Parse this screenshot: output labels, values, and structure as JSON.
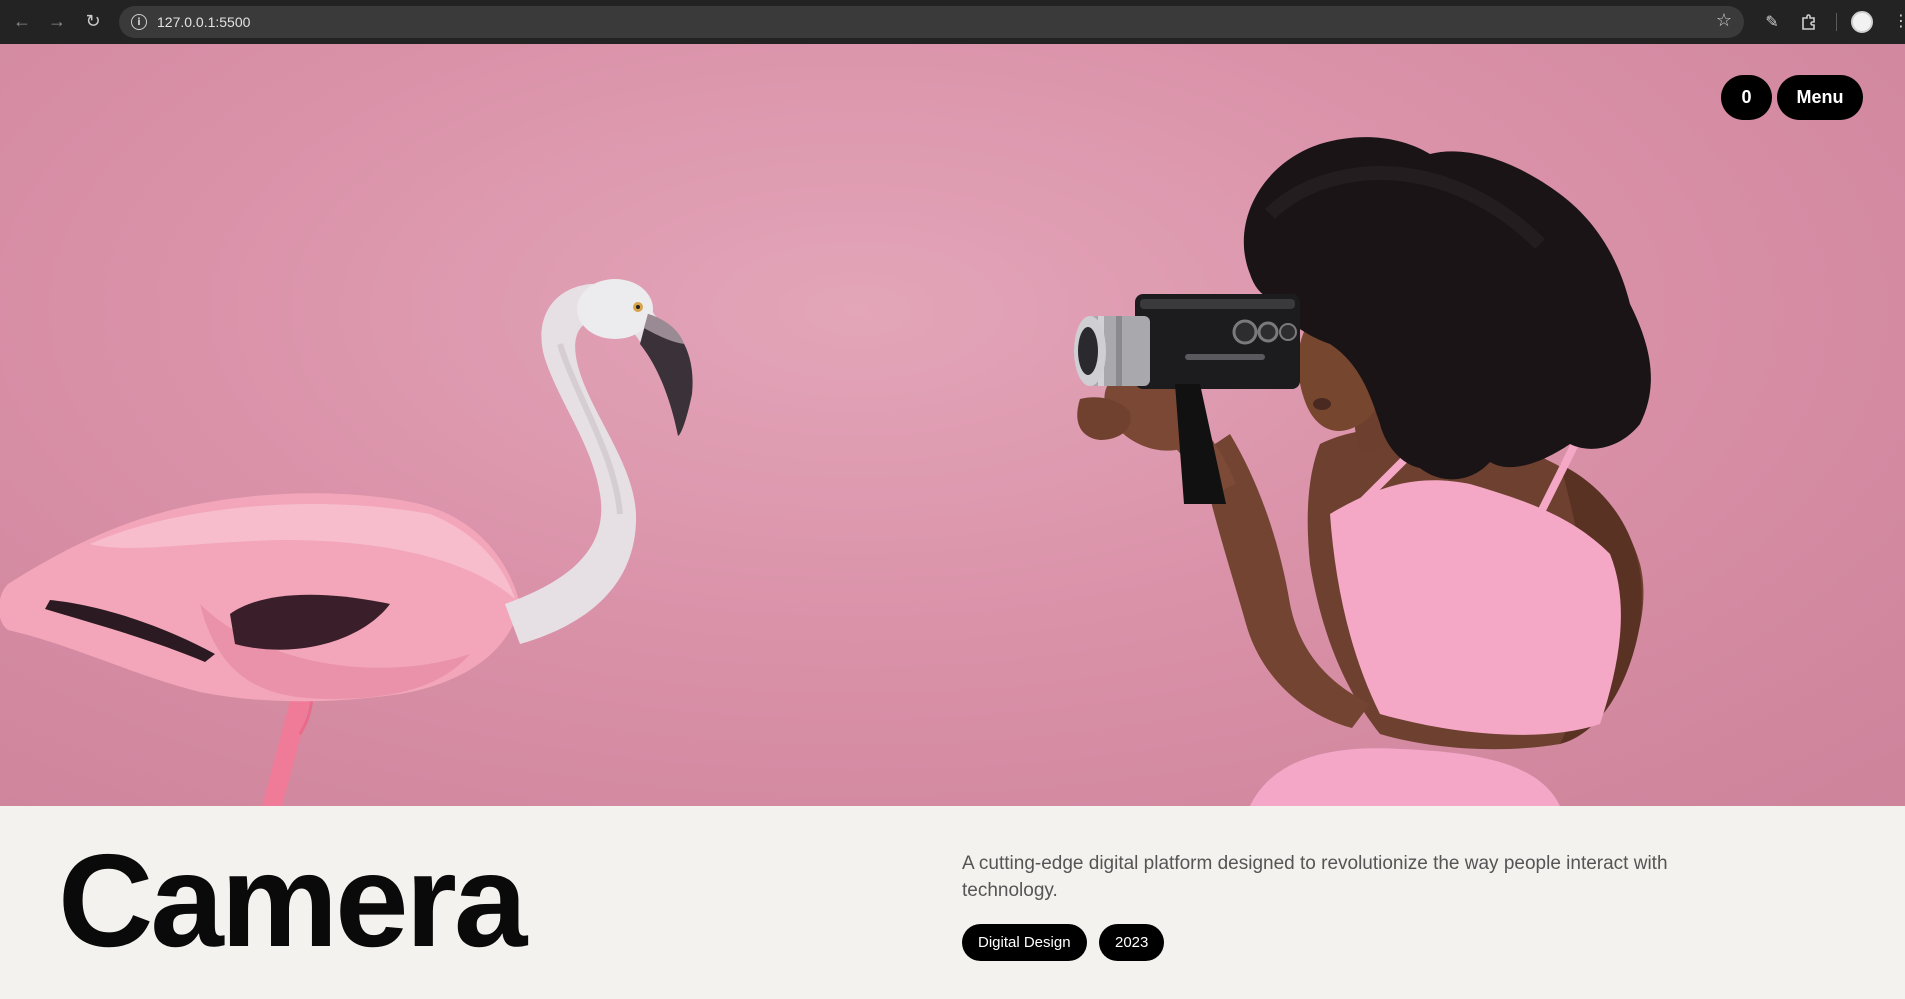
{
  "browser": {
    "url": "127.0.0.1:5500",
    "icons": {
      "back": "back-arrow-icon",
      "forward": "forward-arrow-icon",
      "reload": "reload-icon",
      "site_info": "info-icon",
      "bookmark": "star-icon",
      "edit": "pen-icon",
      "extensions": "puzzle-icon",
      "profile": "avatar-icon",
      "menu": "kebab-icon"
    }
  },
  "header": {
    "cart_count": "0",
    "menu_label": "Menu"
  },
  "project": {
    "title": "Camera",
    "description": "A cutting-edge digital platform designed to revolutionize the way people interact with technology.",
    "tags": [
      "Digital Design",
      "2023"
    ]
  },
  "colors": {
    "hero_background": "#d98ea6",
    "page_background": "#f3f2ee",
    "pill": "#000000",
    "pill_text": "#ffffff"
  }
}
